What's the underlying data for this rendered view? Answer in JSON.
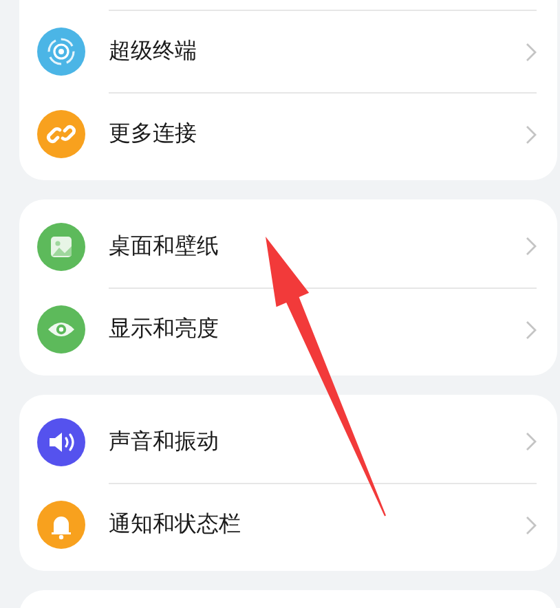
{
  "sections": [
    {
      "items": [
        {
          "label": "超级终端",
          "color": "#4bb5e6"
        },
        {
          "label": "更多连接",
          "color": "#f8a11e"
        }
      ]
    },
    {
      "items": [
        {
          "label": "桌面和壁纸",
          "color": "#5dba5b"
        },
        {
          "label": "显示和亮度",
          "color": "#5dba5b"
        }
      ]
    },
    {
      "items": [
        {
          "label": "声音和振动",
          "color": "#5552ee"
        },
        {
          "label": "通知和状态栏",
          "color": "#f8a11e"
        }
      ]
    }
  ]
}
